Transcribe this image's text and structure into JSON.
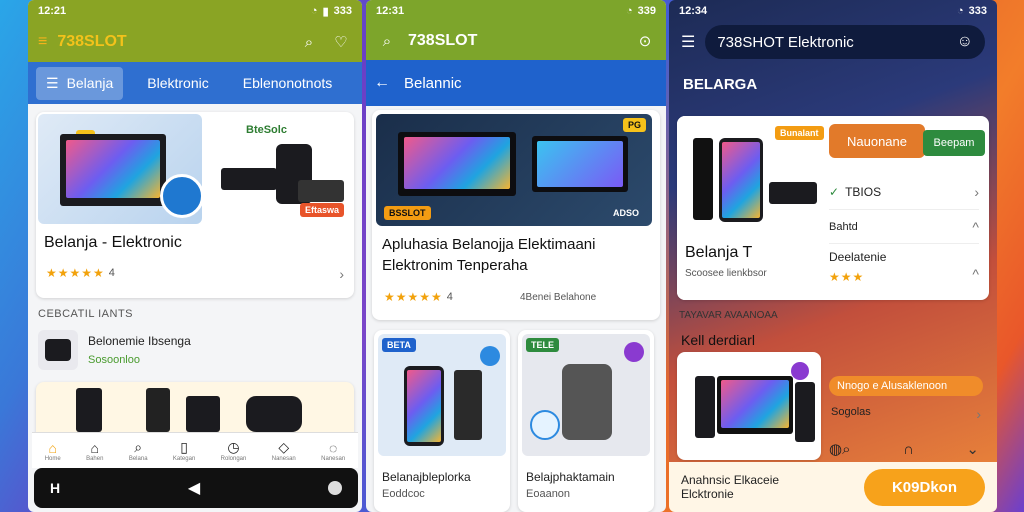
{
  "colors": {
    "s1_header": "#8aa424",
    "s1_tabs": "#2f6fd0",
    "s2_header": "#7da52b",
    "s2_tabs": "#1f62cc",
    "accent_orange": "#f39c12",
    "cta": "#f7a21b",
    "green_btn": "#2e8b3e"
  },
  "screen1": {
    "status": {
      "time": "12:21",
      "battery": "333"
    },
    "brand": "738SLOT",
    "tabs": [
      "Belanja",
      "Blektronic",
      "Eblenonotnots"
    ],
    "featured": {
      "badge": "BteSolc",
      "promo": "Eftaswa",
      "title": "Belanja - Elektronic",
      "rating_stars": "★★★★★",
      "rating_value": "4"
    },
    "section_label": "CEBCATIL IANTS",
    "item": {
      "title": "Belonemie Ibsenga",
      "subtitle": "Sosoonloo"
    },
    "nav": [
      {
        "icon": "home-icon",
        "label": "Home"
      },
      {
        "icon": "home-outline-icon",
        "label": "Bahen"
      },
      {
        "icon": "search-icon",
        "label": "Belana"
      },
      {
        "icon": "book-icon",
        "label": "Kategan"
      },
      {
        "icon": "clock-icon",
        "label": "Rolongan"
      },
      {
        "icon": "shield-icon",
        "label": "Nanesan"
      },
      {
        "icon": "info-icon",
        "label": "Nanesan"
      }
    ],
    "sysbar_left": "H"
  },
  "screen2": {
    "status": {
      "time": "12:31",
      "battery": "339"
    },
    "brand": "738SLOT",
    "tab": "Belannic",
    "featured": {
      "label_left": "BSSLOT",
      "label_right": "ADSO",
      "badge": "PG",
      "title": "Apluhasia Belanojja Elektimaani Elektronim Tenperaha",
      "rating_stars": "★★★★★",
      "rating_value": "4",
      "meta": "4Benei Belahone"
    },
    "products": [
      {
        "badge": "BETA",
        "title": "Belanajbleplorka",
        "subtitle": "Eoddcoc"
      },
      {
        "badge": "TELE",
        "title": "Belajphaktamain",
        "subtitle": "Eoaanon"
      }
    ]
  },
  "screen3": {
    "status": {
      "time": "12:34",
      "battery": "333"
    },
    "search_text": "738SHOT Elektronic",
    "heading": "BELARGA",
    "featured": {
      "tag": "Bunalant",
      "title": "Belanja T",
      "subtitle": "Scoosee lienkbsor"
    },
    "buttons": {
      "orange": "Nauonane",
      "green": "Beepam"
    },
    "list": [
      {
        "title": "TBIOS",
        "icon": "check-icon"
      },
      {
        "title": "Bahtd"
      },
      {
        "title": "Deelatenie",
        "rating_stars": "★★★"
      }
    ],
    "section_label": "TAYAVAR AVAANOAA",
    "section_title": "Kell derdiarl",
    "promo_chip": "Nnogo e Alusaklenoon",
    "promo_sub": "Sogolas",
    "bottom": {
      "title": "Anahnsic Elkaceie Elcktronie",
      "cta": "K09Dkon"
    }
  }
}
